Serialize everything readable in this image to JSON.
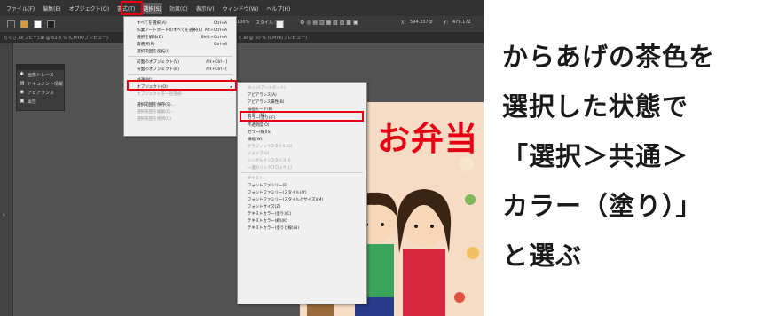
{
  "menubar": {
    "items": [
      "ファイル(F)",
      "編集(E)",
      "オブジェクト(O)",
      "書式(T)",
      "選択(S)",
      "効果(C)",
      "表示(V)",
      "ウィンドウ(W)",
      "ヘルプ(H)"
    ],
    "active_index": 4
  },
  "controlbar": {
    "zoom": "100%",
    "style_label": "スタイル：",
    "x_label": "X：",
    "x_value": "594.337 p",
    "y_label": "Y：",
    "y_value": "479.172"
  },
  "tabs": [
    "ちぐさ.ai(コピー).ai @ 63.6 % (CMYK/プレビュー)",
    "ぐ.ai @ 50 % (CMYK/プレビュー)"
  ],
  "tools_panel": {
    "items": [
      {
        "icon": "image-trace-icon",
        "label": "画像トレース"
      },
      {
        "icon": "document-info-icon",
        "label": "ドキュメント情報"
      },
      {
        "icon": "appearance-icon",
        "label": "アピアランス"
      },
      {
        "icon": "artboard-icon",
        "label": "属性"
      }
    ]
  },
  "artwork": {
    "title": "お弁当"
  },
  "select_menu": {
    "items": [
      {
        "label": "すべてを選択(A)",
        "shortcut": "Ctrl+A",
        "disabled": false
      },
      {
        "label": "作業アートボードのすべてを選択(L)",
        "shortcut": "Alt+Ctrl+A",
        "disabled": false
      },
      {
        "label": "選択を解除(D)",
        "shortcut": "Shift+Ctrl+A",
        "disabled": false
      },
      {
        "label": "再選択(R)",
        "shortcut": "Ctrl+6",
        "disabled": false
      },
      {
        "label": "選択範囲を反転(I)",
        "shortcut": "",
        "disabled": false
      },
      {
        "label": "前面のオブジェクト(V)",
        "shortcut": "Alt+Ctrl+]",
        "disabled": false
      },
      {
        "label": "背面のオブジェクト(B)",
        "shortcut": "Alt+Ctrl+[",
        "disabled": false
      },
      {
        "label": "共通(M)",
        "shortcut": "",
        "disabled": false
      },
      {
        "label": "オブジェクト(O)",
        "shortcut": "",
        "disabled": false
      },
      {
        "label": "オブジェクトを一括選択",
        "shortcut": "",
        "disabled": true
      },
      {
        "label": "選択範囲を保存(S)...",
        "shortcut": "",
        "disabled": false
      },
      {
        "label": "選択範囲を編集(E)...",
        "shortcut": "",
        "disabled": true
      },
      {
        "label": "選択範囲を更新(U)",
        "shortcut": "",
        "disabled": true
      }
    ]
  },
  "common_submenu": {
    "items": [
      {
        "label": "エッジ(アートボード)",
        "disabled": true
      },
      {
        "label": "アピアランス(A)",
        "disabled": false
      },
      {
        "label": "アピアランス属性(B)",
        "disabled": false
      },
      {
        "label": "描画モード(B)",
        "disabled": false
      },
      {
        "label": "カラー(線)",
        "disabled": false
      },
      {
        "label": "カラー(塗り)(F)",
        "disabled": false
      },
      {
        "label": "不透明度(O)",
        "disabled": false
      },
      {
        "label": "カラー(線)(S)",
        "disabled": false
      },
      {
        "label": "線幅(W)",
        "disabled": false
      },
      {
        "label": "グラフィックスタイル(G)",
        "disabled": true
      },
      {
        "label": "シェイプ(H)",
        "disabled": true
      },
      {
        "label": "シンボルインスタンス(I)",
        "disabled": true
      },
      {
        "label": "一連のリンクブロック(L)",
        "disabled": true
      },
      {
        "label": "テキスト",
        "disabled": true
      },
      {
        "label": "フォントファミリー(F)",
        "disabled": false
      },
      {
        "label": "フォントファミリー(スタイル)(Y)",
        "disabled": false
      },
      {
        "label": "フォントファミリー(スタイルとサイズ)(M)",
        "disabled": false
      },
      {
        "label": "フォントサイズ(Z)",
        "disabled": false
      },
      {
        "label": "テキストカラー(塗り)(C)",
        "disabled": false
      },
      {
        "label": "テキストカラー(線)(K)",
        "disabled": false
      },
      {
        "label": "テキストカラー(塗りと線)(B)",
        "disabled": false
      }
    ]
  },
  "caption": {
    "lines": [
      "からあげの茶色を",
      "選択した状態で",
      "「選択＞共通＞",
      "カラー（塗り）」",
      "と選ぶ"
    ]
  },
  "colors": {
    "highlight": "#e60012",
    "ui_dark": "#323232",
    "menu_bg": "#f0f0f0"
  }
}
